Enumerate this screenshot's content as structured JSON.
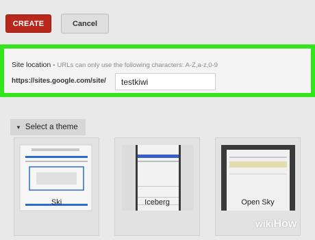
{
  "toolbar": {
    "create_label": "CREATE",
    "cancel_label": "Cancel"
  },
  "site_location": {
    "title": "Site location -",
    "hint": "URLs can only use the following characters: A-Z,a-z,0-9",
    "url_prefix": "https://sites.google.com/site/",
    "value": "testkiwi"
  },
  "themes": {
    "toggle_label": "Select a theme",
    "items": [
      {
        "name": "Ski"
      },
      {
        "name": "Iceberg"
      },
      {
        "name": "Open Sky"
      }
    ]
  },
  "watermark": {
    "prefix": "wiki",
    "suffix": "How"
  },
  "colors": {
    "create_button": "#b8281d",
    "highlight": "#33e51b",
    "ski_blue": "#2a6bd0",
    "iceberg_blue": "#3a5ec8",
    "open_sky_header": "#3a3a3a",
    "open_sky_band": "#e3dcae"
  }
}
